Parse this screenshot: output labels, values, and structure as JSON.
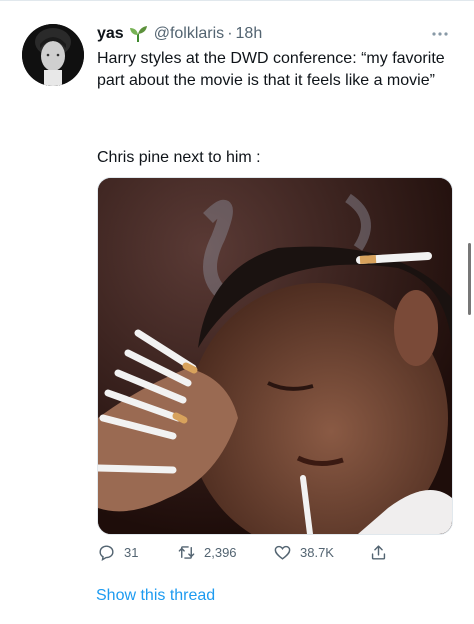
{
  "tweet": {
    "display_name": "yas",
    "emoji_icon": "seedling-icon",
    "handle": "@folklaris",
    "dot": "·",
    "time": "18h",
    "text_line1": "Harry styles at the DWD conference: “my favorite part about the movie is that it feels like a movie”",
    "text_line2": "Chris pine next to him :"
  },
  "actions": {
    "reply_count": "31",
    "retweet_count": "2,396",
    "like_count": "38.7K"
  },
  "show_thread_label": "Show this thread",
  "colors": {
    "link_blue": "#1d9bf0",
    "muted_gray": "#536471",
    "text_dark": "#0f1419"
  }
}
